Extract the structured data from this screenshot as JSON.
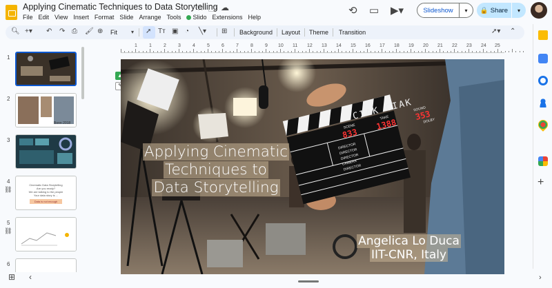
{
  "app": {
    "title": "Applying Cinematic Techniques to Data Storytelling",
    "menu": [
      "File",
      "Edit",
      "View",
      "Insert",
      "Format",
      "Slide",
      "Arrange",
      "Tools",
      "Slido",
      "Extensions",
      "Help"
    ],
    "slideshow_label": "Slideshow",
    "share_label": "Share"
  },
  "toolbar": {
    "zoom": "Fit",
    "background_label": "Background",
    "layout_label": "Layout",
    "theme_label": "Theme",
    "transition_label": "Transition"
  },
  "filmstrip": {
    "slides": [
      {
        "number": "1",
        "selected": true
      },
      {
        "number": "2",
        "caption": "Bonn 2018"
      },
      {
        "number": "3"
      },
      {
        "number": "4",
        "lines": [
          "Cinematic Data Storytelling",
          "Are you ready?",
          "We are talking to the people",
          "Your data story is ..."
        ],
        "badge": "Data is not enough"
      },
      {
        "number": "5"
      },
      {
        "number": "6"
      }
    ]
  },
  "ruler": {
    "labels": [
      "1",
      "1",
      "2",
      "3",
      "4",
      "5",
      "6",
      "7",
      "8",
      "9",
      "10",
      "11",
      "12",
      "13",
      "14",
      "15",
      "16",
      "17",
      "18",
      "19",
      "20",
      "21",
      "22",
      "23",
      "24",
      "25"
    ]
  },
  "slide": {
    "title_lines": [
      "Applying Cinematic",
      "Techniques to",
      "Data Storytelling"
    ],
    "author_lines": [
      "Angelica Lo Duca",
      "IIT-CNR, Italy"
    ],
    "clapper": {
      "header": "CIAK  CIAK",
      "scene_label": "SCENE",
      "take_label": "TAKE",
      "sound_label": "SOUND",
      "scene_value": "833",
      "take_value": "1388",
      "sound_value": "353",
      "dolby_label": "DOLBY",
      "director_labels": [
        "DIRECTOR",
        "DIRECTOR",
        "DIRECTOR",
        "CAMERA",
        "DIRECTOR"
      ]
    }
  },
  "colors": {
    "accent": "#0b57d0",
    "share_bg": "#c2e7ff",
    "title_box": "#c8b496"
  }
}
